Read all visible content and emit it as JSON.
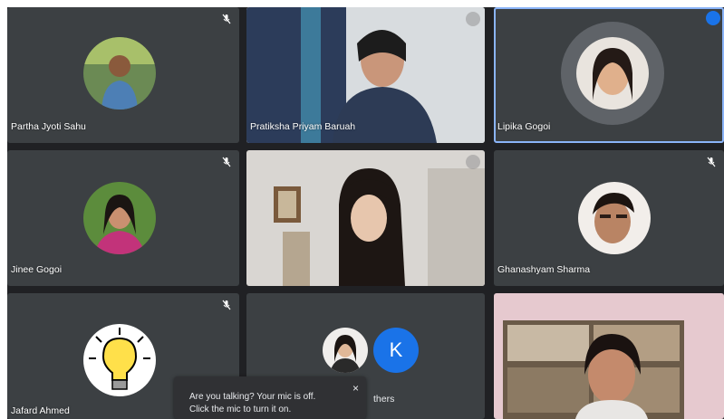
{
  "participants": [
    {
      "name": "Partha Jyoti Sahu",
      "mic": "muted"
    },
    {
      "name": "Pratiksha Priyam Baruah",
      "mic": "muted"
    },
    {
      "name": "Lipika Gogoi",
      "mic": "speaking"
    },
    {
      "name": "Jinee Gogoi",
      "mic": "muted"
    },
    {
      "name": "",
      "mic": "muted"
    },
    {
      "name": "Ghanashyam Sharma",
      "mic": "muted"
    },
    {
      "name": "Jafard Ahmed",
      "mic": "muted"
    },
    {
      "name": "",
      "mic": ""
    },
    {
      "name": "",
      "mic": ""
    }
  ],
  "others_tile": {
    "avatar_letter": "K",
    "label_partial": "thers"
  },
  "toast": {
    "line1": "Are you talking? Your mic is off.",
    "line2": "Click the mic to turn it on.",
    "close_glyph": "×"
  },
  "colors": {
    "tile": "#3c4043",
    "background": "#202124",
    "accent": "#1a73e8",
    "active_border": "#8ab4f8"
  }
}
